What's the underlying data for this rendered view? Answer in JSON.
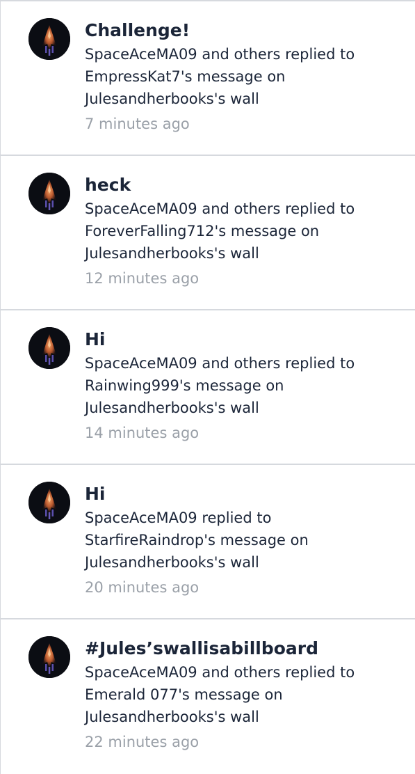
{
  "notifications": [
    {
      "title": "Challenge!",
      "message": "SpaceAceMA09 and others replied to EmpressKat7's message on Julesandherbooks's wall",
      "time": "7 minutes ago"
    },
    {
      "title": "heck",
      "message": "SpaceAceMA09 and others replied to ForeverFalling712's message on Julesandherbooks's wall",
      "time": "12 minutes ago"
    },
    {
      "title": "Hi",
      "message": "SpaceAceMA09 and others replied to Rainwing999's message on Julesandherbooks's wall",
      "time": "14 minutes ago"
    },
    {
      "title": "Hi",
      "message": "SpaceAceMA09 replied to StarfireRaindrop's message on Julesandherbooks's wall",
      "time": "20 minutes ago"
    },
    {
      "title": "#Jules’swallisabillboard",
      "message": "SpaceAceMA09 and others replied to Emerald 077's message on Julesandherbooks's wall",
      "time": "22 minutes ago"
    }
  ],
  "colors": {
    "title": "#1b2538",
    "body": "#1b2538",
    "timestamp": "#9aa0a8",
    "divider": "#d6d9de",
    "avatar_bg": "#0b0d13"
  },
  "icons": {
    "avatar": "spaceship-avatar-icon"
  }
}
